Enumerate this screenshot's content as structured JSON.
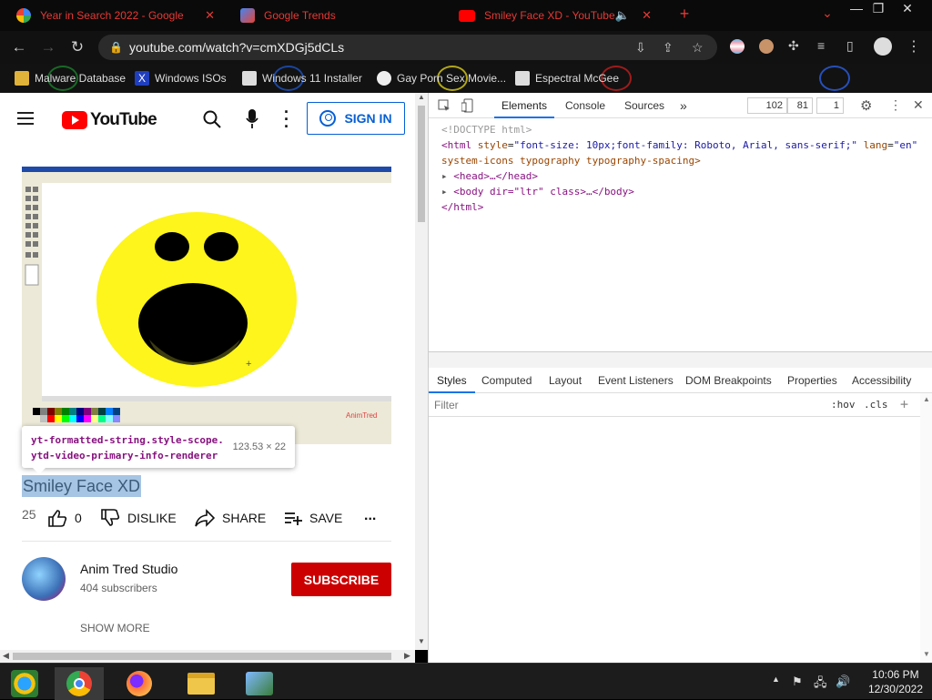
{
  "window": {
    "tabs": [
      {
        "label": "Year in Search 2022 - Google",
        "icon": "google-icon"
      },
      {
        "label": "Google Trends",
        "icon": "trends-icon"
      },
      {
        "label": "Smiley Face XD - YouTube",
        "icon": "youtube-icon"
      }
    ],
    "new_tab": "+",
    "controls": {
      "minimize": "—",
      "maximize": "❐",
      "close": "✕",
      "tab_list": "⌄"
    }
  },
  "omnibox": {
    "url": "youtube.com/watch?v=cmXDGj5dCLs",
    "icons": [
      "install-icon",
      "share-icon",
      "star-icon"
    ]
  },
  "bookmarks": [
    {
      "label": "Malware Database",
      "icon": "folder-icon"
    },
    {
      "label": "Windows ISOs",
      "icon": "x-icon"
    },
    {
      "label": "Windows 11 Installer",
      "icon": "page-icon"
    },
    {
      "label": "Gay Porn Sex Movie...",
      "icon": "globe-icon"
    },
    {
      "label": "Espectral McGee",
      "icon": "page-icon"
    }
  ],
  "youtube": {
    "logo_text": "YouTube",
    "sign_in": "SIGN IN",
    "tooltip": {
      "line1": "yt-formatted-string.style-scope.",
      "line2": "ytd-video-primary-info-renderer",
      "dims": "123.53 × 22"
    },
    "video_title": "Smiley Face XD",
    "views": "25",
    "likes": "0",
    "dislike": "DISLIKE",
    "share": "SHARE",
    "save": "SAVE",
    "more": "...",
    "channel_name": "Anim Tred Studio",
    "subscribers": "404 subscribers",
    "subscribe": "SUBSCRIBE",
    "show_more": "SHOW MORE",
    "paint_watermark": "AnimTred"
  },
  "devtools": {
    "tabs": [
      "Elements",
      "Console",
      "Sources",
      "»"
    ],
    "nums": [
      "102",
      "81",
      "1"
    ],
    "dom": {
      "doctype": "<!DOCTYPE html>",
      "html_open": "<html",
      "style_attr": "style",
      "style_val": "\"font-size: 10px;font-family: Roboto, Arial, sans-serif;\"",
      "lang_attr": "lang",
      "lang_val": "\"en\"",
      "html_line2": "system-icons typography typography-spacing>",
      "head": "<head>…</head>",
      "body": "<body dir=\"ltr\" class>…</body>",
      "html_close": "</html>"
    },
    "style_tabs": [
      "Styles",
      "Computed",
      "Layout",
      "Event Listeners",
      "DOM Breakpoints",
      "Properties",
      "Accessibility"
    ],
    "filter_placeholder": "Filter",
    "hov": ":hov",
    "cls": ".cls",
    "plus": "+"
  },
  "taskbar": {
    "time": "10:06 PM",
    "date": "12/30/2022",
    "apps": [
      "start-icon",
      "chrome-icon",
      "firefox-icon",
      "file-explorer-icon",
      "network-app-icon"
    ]
  },
  "colors": {
    "youtube_red": "#ff0000",
    "subscribe_red": "#cc0000",
    "link_blue": "#065fd4",
    "devtools_blue": "#1a73e8",
    "tab_red": "#e53935"
  }
}
